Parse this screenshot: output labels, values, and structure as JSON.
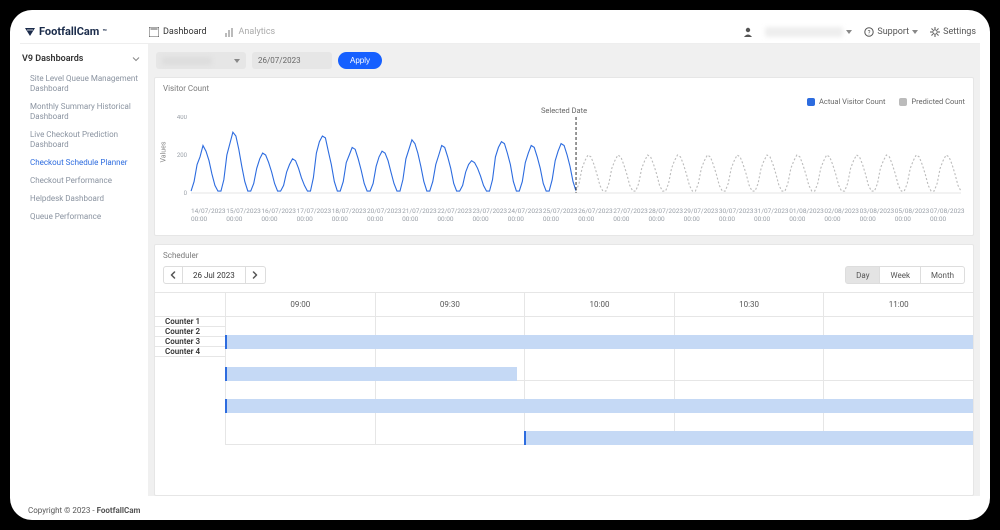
{
  "brand": {
    "name": "FootfallCam",
    "tm": "™"
  },
  "nav": {
    "dashboard": "Dashboard",
    "analytics": "Analytics"
  },
  "top": {
    "support": "Support",
    "settings": "Settings"
  },
  "sidebar": {
    "heading": "V9 Dashboards",
    "items": [
      {
        "label": "Site Level Queue Management Dashboard"
      },
      {
        "label": "Monthly Summary Historical Dashboard"
      },
      {
        "label": "Live Checkout Prediction Dashboard"
      },
      {
        "label": "Checkout Schedule Planner"
      },
      {
        "label": "Checkout Performance"
      },
      {
        "label": "Helpdesk Dashboard"
      },
      {
        "label": "Queue Performance"
      }
    ],
    "activeIndex": 3
  },
  "filter": {
    "date": "26/07/2023",
    "apply": "Apply"
  },
  "chart": {
    "title": "Visitor Count",
    "ylabel": "Values",
    "selected_date_label": "Selected Date",
    "legend": {
      "actual": "Actual Visitor Count",
      "predicted": "Predicted Count"
    },
    "ymax": 400,
    "yticks": [
      0,
      200,
      400
    ],
    "xticks": [
      "14/07/2023 00:00",
      "15/07/2023 00:00",
      "16/07/2023 00:00",
      "17/07/2023 00:00",
      "18/07/2023 00:00",
      "20/07/2023 00:00",
      "21/07/2023 00:00",
      "22/07/2023 00:00",
      "23/07/2023 00:00",
      "24/07/2023 00:00",
      "25/07/2023 00:00",
      "26/07/2023 00:00",
      "27/07/2023 00:00",
      "28/07/2023 00:00",
      "29/07/2023 00:00",
      "30/07/2023 00:00",
      "31/07/2023 00:00",
      "01/08/2023 00:00",
      "02/08/2023 00:00",
      "03/08/2023 00:00",
      "05/08/2023 00:00",
      "07/08/2023 00:00"
    ]
  },
  "chart_data": {
    "type": "line",
    "ylabel": "Values",
    "ylim": [
      0,
      400
    ],
    "selected_date": "26/07/2023",
    "series": [
      {
        "name": "Actual Visitor Count",
        "color": "#2d6cdf",
        "x": [
          "14/07/2023",
          "15/07/2023",
          "16/07/2023",
          "17/07/2023",
          "18/07/2023",
          "19/07/2023",
          "20/07/2023",
          "21/07/2023",
          "22/07/2023",
          "23/07/2023",
          "24/07/2023",
          "25/07/2023",
          "26/07/2023"
        ],
        "values_daily": [
          [
            10,
            60,
            150,
            190,
            250,
            220,
            170,
            100,
            40,
            10
          ],
          [
            10,
            70,
            200,
            260,
            320,
            300,
            230,
            140,
            60,
            10
          ],
          [
            10,
            50,
            130,
            180,
            210,
            200,
            160,
            110,
            50,
            10
          ],
          [
            10,
            40,
            110,
            150,
            180,
            170,
            130,
            80,
            40,
            10
          ],
          [
            10,
            80,
            210,
            270,
            300,
            290,
            220,
            150,
            60,
            10
          ],
          [
            10,
            60,
            160,
            200,
            240,
            230,
            180,
            120,
            50,
            10
          ],
          [
            10,
            50,
            140,
            190,
            220,
            210,
            170,
            110,
            50,
            10
          ],
          [
            10,
            70,
            180,
            230,
            280,
            260,
            210,
            140,
            60,
            10
          ],
          [
            10,
            60,
            150,
            200,
            250,
            240,
            190,
            130,
            50,
            10
          ],
          [
            10,
            40,
            110,
            150,
            170,
            160,
            130,
            90,
            40,
            10
          ],
          [
            10,
            70,
            190,
            240,
            270,
            260,
            210,
            150,
            60,
            10
          ],
          [
            10,
            60,
            160,
            210,
            250,
            240,
            190,
            130,
            50,
            10
          ],
          [
            10,
            70,
            170,
            220,
            260,
            250,
            200,
            140,
            60,
            10
          ]
        ]
      },
      {
        "name": "Predicted Count",
        "color": "#bbb",
        "x": [
          "27/07/2023",
          "28/07/2023",
          "29/07/2023",
          "30/07/2023",
          "31/07/2023",
          "01/08/2023",
          "02/08/2023",
          "03/08/2023",
          "04/08/2023",
          "05/08/2023",
          "06/08/2023",
          "07/08/2023",
          "08/08/2023"
        ],
        "values_daily": [
          [
            10,
            50,
            130,
            170,
            200,
            190,
            150,
            100,
            40,
            10
          ],
          [
            10,
            50,
            130,
            170,
            200,
            190,
            150,
            100,
            40,
            10
          ],
          [
            10,
            50,
            130,
            170,
            200,
            190,
            150,
            100,
            40,
            10
          ],
          [
            10,
            50,
            130,
            170,
            200,
            190,
            150,
            100,
            40,
            10
          ],
          [
            10,
            50,
            130,
            170,
            200,
            190,
            150,
            100,
            40,
            10
          ],
          [
            10,
            50,
            130,
            170,
            200,
            190,
            150,
            100,
            40,
            10
          ],
          [
            10,
            50,
            130,
            170,
            200,
            190,
            150,
            100,
            40,
            10
          ],
          [
            10,
            50,
            130,
            170,
            200,
            190,
            150,
            100,
            40,
            10
          ],
          [
            10,
            50,
            130,
            170,
            200,
            190,
            150,
            100,
            40,
            10
          ],
          [
            10,
            50,
            130,
            170,
            200,
            190,
            150,
            100,
            40,
            10
          ],
          [
            10,
            50,
            130,
            170,
            200,
            190,
            150,
            100,
            40,
            10
          ],
          [
            10,
            50,
            130,
            170,
            200,
            190,
            150,
            100,
            40,
            10
          ],
          [
            10,
            50,
            130,
            170,
            200,
            190,
            150,
            100,
            40,
            10
          ]
        ]
      }
    ]
  },
  "scheduler": {
    "title": "Scheduler",
    "date": "26 Jul 2023",
    "views": {
      "day": "Day",
      "week": "Week",
      "month": "Month"
    },
    "activeView": "day",
    "columns": [
      "09:00",
      "09:30",
      "10:00",
      "10:30",
      "11:00"
    ],
    "rows": [
      {
        "label": "Counter 1",
        "bar": {
          "start": 0,
          "end": 100
        }
      },
      {
        "label": "Counter 2",
        "bar": {
          "start": 0,
          "end": 39
        }
      },
      {
        "label": "Counter 3",
        "bar": {
          "start": 0,
          "end": 100
        }
      },
      {
        "label": "Counter 4",
        "bar": {
          "start": 40,
          "end": 100
        }
      }
    ]
  },
  "footer": {
    "copyright": "Copyright © 2023 - ",
    "brand": "FootfallCam"
  }
}
